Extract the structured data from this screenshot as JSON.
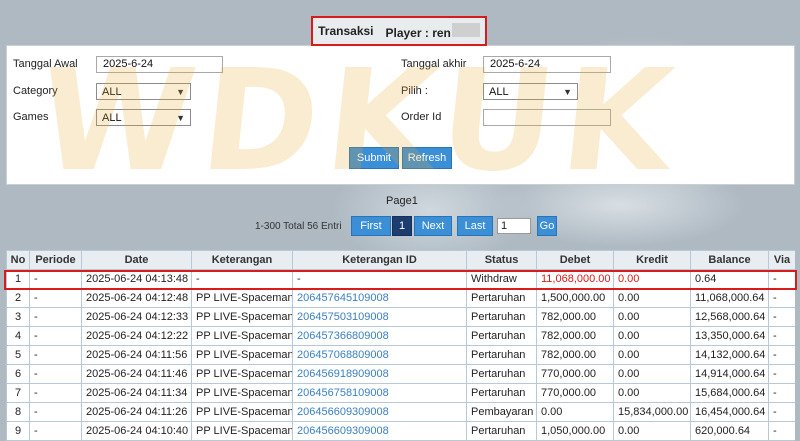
{
  "header": {
    "title_prefix": "Transaksi",
    "title_player": "Player : ren"
  },
  "filters": {
    "tanggal_awal_label": "Tanggal Awal",
    "tanggal_awal_value": "2025-6-24",
    "tanggal_akhir_label": "Tanggal akhir",
    "tanggal_akhir_value": "2025-6-24",
    "category_label": "Category",
    "category_value": "ALL",
    "pilih_label": "Pilih  :",
    "pilih_value": "ALL",
    "games_label": "Games",
    "games_value": "ALL",
    "order_id_label": "Order Id",
    "order_id_value": ""
  },
  "actions": {
    "submit_label": "Submit",
    "refresh_label": "Refresh"
  },
  "pager": {
    "title": "Page1",
    "total_text": "1-300 Total 56 Entri",
    "first_label": "First",
    "current_label": "1",
    "next_label": "Next",
    "last_label": "Last",
    "page_input_value": "1",
    "go_label": "Go"
  },
  "watermark": "WDKUK",
  "table": {
    "columns": [
      "No",
      "Periode",
      "Date",
      "Keterangan",
      "Keterangan ID",
      "Status",
      "Debet",
      "Kredit",
      "Balance",
      "Via"
    ],
    "rows": [
      [
        "1",
        "-",
        "2025-06-24 04:13:48",
        "-",
        "-",
        "Withdraw",
        "11,068,000.00",
        "0.00",
        "0.64",
        "-"
      ],
      [
        "2",
        "-",
        "2025-06-24 04:12:48",
        "PP LIVE-Spaceman",
        "206457645109008",
        "Pertaruhan",
        "1,500,000.00",
        "0.00",
        "11,068,000.64",
        "-"
      ],
      [
        "3",
        "-",
        "2025-06-24 04:12:33",
        "PP LIVE-Spaceman",
        "206457503109008",
        "Pertaruhan",
        "782,000.00",
        "0.00",
        "12,568,000.64",
        "-"
      ],
      [
        "4",
        "-",
        "2025-06-24 04:12:22",
        "PP LIVE-Spaceman",
        "206457366809008",
        "Pertaruhan",
        "782,000.00",
        "0.00",
        "13,350,000.64",
        "-"
      ],
      [
        "5",
        "-",
        "2025-06-24 04:11:56",
        "PP LIVE-Spaceman",
        "206457068809008",
        "Pertaruhan",
        "782,000.00",
        "0.00",
        "14,132,000.64",
        "-"
      ],
      [
        "6",
        "-",
        "2025-06-24 04:11:46",
        "PP LIVE-Spaceman",
        "206456918909008",
        "Pertaruhan",
        "770,000.00",
        "0.00",
        "14,914,000.64",
        "-"
      ],
      [
        "7",
        "-",
        "2025-06-24 04:11:34",
        "PP LIVE-Spaceman",
        "206456758109008",
        "Pertaruhan",
        "770,000.00",
        "0.00",
        "15,684,000.64",
        "-"
      ],
      [
        "8",
        "-",
        "2025-06-24 04:11:26",
        "PP LIVE-Spaceman",
        "206456609309008",
        "Pembayaran",
        "0.00",
        "15,834,000.00",
        "16,454,000.64",
        "-"
      ],
      [
        "9",
        "-",
        "2025-06-24 04:10:40",
        "PP LIVE-Spaceman",
        "206456609309008",
        "Pertaruhan",
        "1,050,000.00",
        "0.00",
        "620,000.64",
        "-"
      ]
    ]
  }
}
